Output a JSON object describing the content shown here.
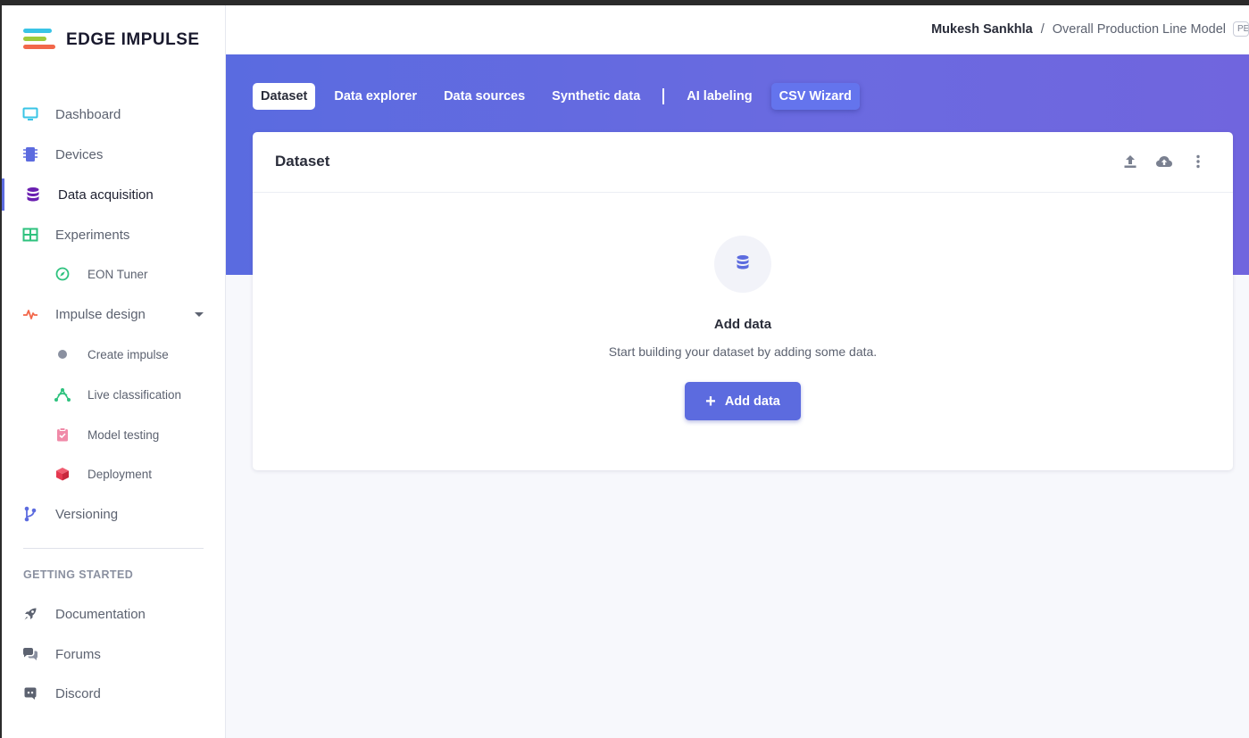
{
  "brand": {
    "name": "EDGE IMPULSE"
  },
  "sidebar": {
    "items": [
      {
        "label": "Dashboard",
        "icon": "monitor-icon",
        "color": "#39c4e6"
      },
      {
        "label": "Devices",
        "icon": "chip-icon",
        "color": "#5c6bdf"
      },
      {
        "label": "Data acquisition",
        "icon": "database-icon",
        "color": "#6a1fb0",
        "active": true
      },
      {
        "label": "Experiments",
        "icon": "table-icon",
        "color": "#2ec27e"
      },
      {
        "label": "EON Tuner",
        "icon": "compass-icon",
        "color": "#2ec27e"
      },
      {
        "label": "Impulse design",
        "icon": "pulse-icon",
        "color": "#f2674a"
      },
      {
        "label": "Create impulse",
        "icon": "dot-icon",
        "color": "#8a90a0"
      },
      {
        "label": "Live classification",
        "icon": "network-icon",
        "color": "#2ec27e"
      },
      {
        "label": "Model testing",
        "icon": "clipboard-check-icon",
        "color": "#f08aa8"
      },
      {
        "label": "Deployment",
        "icon": "cube-icon",
        "color": "#e5384f"
      },
      {
        "label": "Versioning",
        "icon": "branch-icon",
        "color": "#5c6bdf"
      }
    ],
    "section_title": "GETTING STARTED",
    "getting_started": [
      {
        "label": "Documentation",
        "icon": "rocket-icon"
      },
      {
        "label": "Forums",
        "icon": "chat-icon"
      },
      {
        "label": "Discord",
        "icon": "discord-icon"
      }
    ]
  },
  "header": {
    "user": "Mukesh Sankhla",
    "separator": "/",
    "project": "Overall Production Line Model",
    "badge": "PE"
  },
  "tabs": [
    {
      "label": "Dataset",
      "active": true
    },
    {
      "label": "Data explorer"
    },
    {
      "label": "Data sources"
    },
    {
      "label": "Synthetic data"
    },
    {
      "label": "AI labeling"
    },
    {
      "label": "CSV Wizard",
      "highlight": true
    }
  ],
  "card": {
    "title": "Dataset",
    "actions": [
      "upload-icon",
      "cloud-upload-icon",
      "more-vertical-icon"
    ],
    "empty_title": "Add data",
    "empty_subtitle": "Start building your dataset by adding some data.",
    "button_label": "Add data"
  },
  "colors": {
    "accent": "#5c6bdf",
    "banner_start": "#5a6be0",
    "banner_end": "#7065de"
  }
}
